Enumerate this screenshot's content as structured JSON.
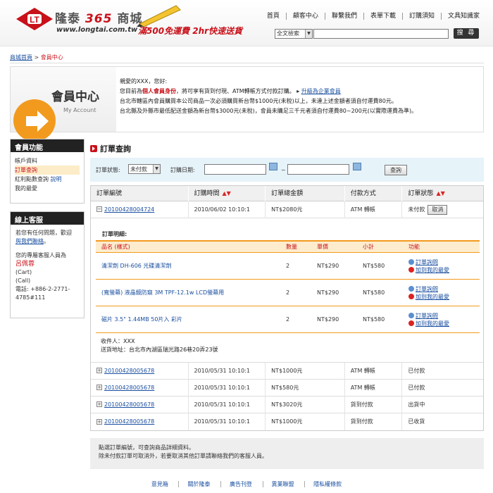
{
  "header": {
    "logo_name": "隆泰",
    "logo_num": "365",
    "logo_tail": "商城",
    "logo_url": "www.longtai.com.tw",
    "promo": "滿500免運費 2hr快速送貨",
    "nav": [
      "首頁",
      "顧客中心",
      "聯繫我們",
      "表單下載",
      "訂購須知",
      "文具知識家"
    ],
    "search_scope": "全文檢索",
    "search_value": "",
    "search_button": "搜 尋"
  },
  "breadcrumb": {
    "home": "商城首頁",
    "sep": " > ",
    "current": "會員中心"
  },
  "banner": {
    "title": "會員中心",
    "subtitle": "My Account",
    "greeting": "親愛的XXX，您好:",
    "line1_a": "您目前為",
    "line1_hl": "個人會員身份",
    "line1_b": "，將可享有貨到付現、ATM轉帳方式付款訂購。",
    "line1_link": "升級為企業會員",
    "line2": "台北市轄區內會員購買本公司商品一次必須購買新台幣$1000元(未稅)以上，未達上述金額者須自付運費80元。",
    "line3": "台北縣及外縣市最低配送金額為新台幣$3000元(未稅)，會員未購足三千元者須自付運費80~200元(以實際運費為準)。"
  },
  "sidebar": {
    "member_title": "會員功能",
    "items": [
      "帳戶資料",
      "訂單查詢",
      "紅利點數查詢",
      "我的最愛"
    ],
    "bonus_explain": "說明",
    "service_title": "線上客服",
    "service_q": "若您有任何問題，歡迎",
    "service_link": "與我們聯絡",
    "service_q_end": "。",
    "rep_label": "您的專屬客服人員為",
    "rep_name": "呂佩蓉",
    "cart": "(Cart)",
    "call": "(Call)",
    "phone": "電話: +886-2-2771-4785#111"
  },
  "main": {
    "title": "訂單查詢",
    "filter": {
      "status_label": "訂單狀態:",
      "status_value": "未付款",
      "date_label": "訂購日期:",
      "date_sep": "~",
      "query_button": "查詢"
    },
    "columns": [
      "訂單編號",
      "訂購時間",
      "訂單總金額",
      "付款方式",
      "訂單狀態"
    ],
    "sort_arrows": "▲▼",
    "orders": [
      {
        "id": "20100428004724",
        "time": "2010/06/02 10:10:1",
        "total": "NT$2080元",
        "pay": "ATM 轉帳",
        "status": "未付款",
        "action": "取消",
        "toggle": "−"
      },
      {
        "id": "20100428005678",
        "time": "2010/05/31 10:10:1",
        "total": "NT$1000元",
        "pay": "ATM 轉帳",
        "status": "已付款",
        "toggle": "+"
      },
      {
        "id": "20100428005678",
        "time": "2010/05/31 10:10:1",
        "total": "NT$580元",
        "pay": "ATM 轉帳",
        "status": "已付款",
        "toggle": "+"
      },
      {
        "id": "20100428005678",
        "time": "2010/05/31 10:10:1",
        "total": "NT$3020元",
        "pay": "貨到付款",
        "status": "出貨中",
        "toggle": "+"
      },
      {
        "id": "20100428005678",
        "time": "2010/05/31 10:10:1",
        "total": "NT$1000元",
        "pay": "貨到付款",
        "status": "已收貨",
        "toggle": "+"
      }
    ],
    "detail": {
      "title": "訂單明細:",
      "columns": [
        "品名 (樣式)",
        "數量",
        "單價",
        "小計",
        "功能"
      ],
      "items": [
        {
          "name": "清潔劑 DH-606 光碟清潔劑",
          "qty": "2",
          "price": "NT$290",
          "sub": "NT$580",
          "f1": "訂單詢問",
          "f2": "加到我的最愛"
        },
        {
          "name": "(寬螢幕) 液晶鏡防窺 3M TPF-12.1w LCD螢幕用",
          "qty": "2",
          "price": "NT$290",
          "sub": "NT$580",
          "f1": "訂單詢問",
          "f2": "加到我的最愛"
        },
        {
          "name": "磁片 3.5\" 1.44MB 50片入 彩片",
          "qty": "2",
          "price": "NT$290",
          "sub": "NT$580",
          "f1": "訂單詢問",
          "f2": "加到我的最愛"
        }
      ],
      "receiver": "收件人：XXX",
      "address": "送貨地址：台北市內湖區瑞光路26巷20弄23號"
    },
    "note1": "點選訂單編號，可查詢商品詳細資料。",
    "note2": "除未付款訂單可取消外，若要取消其他訂單請聯絡我們的客服人員。"
  },
  "footer": [
    "意見箱",
    "關於隆泰",
    "廣告刊登",
    "異業聯盟",
    "隱私權條款"
  ],
  "colors": {
    "brand_red": "#c8111a",
    "accent_orange": "#f29a1e",
    "link_blue": "#1a4fa0"
  }
}
